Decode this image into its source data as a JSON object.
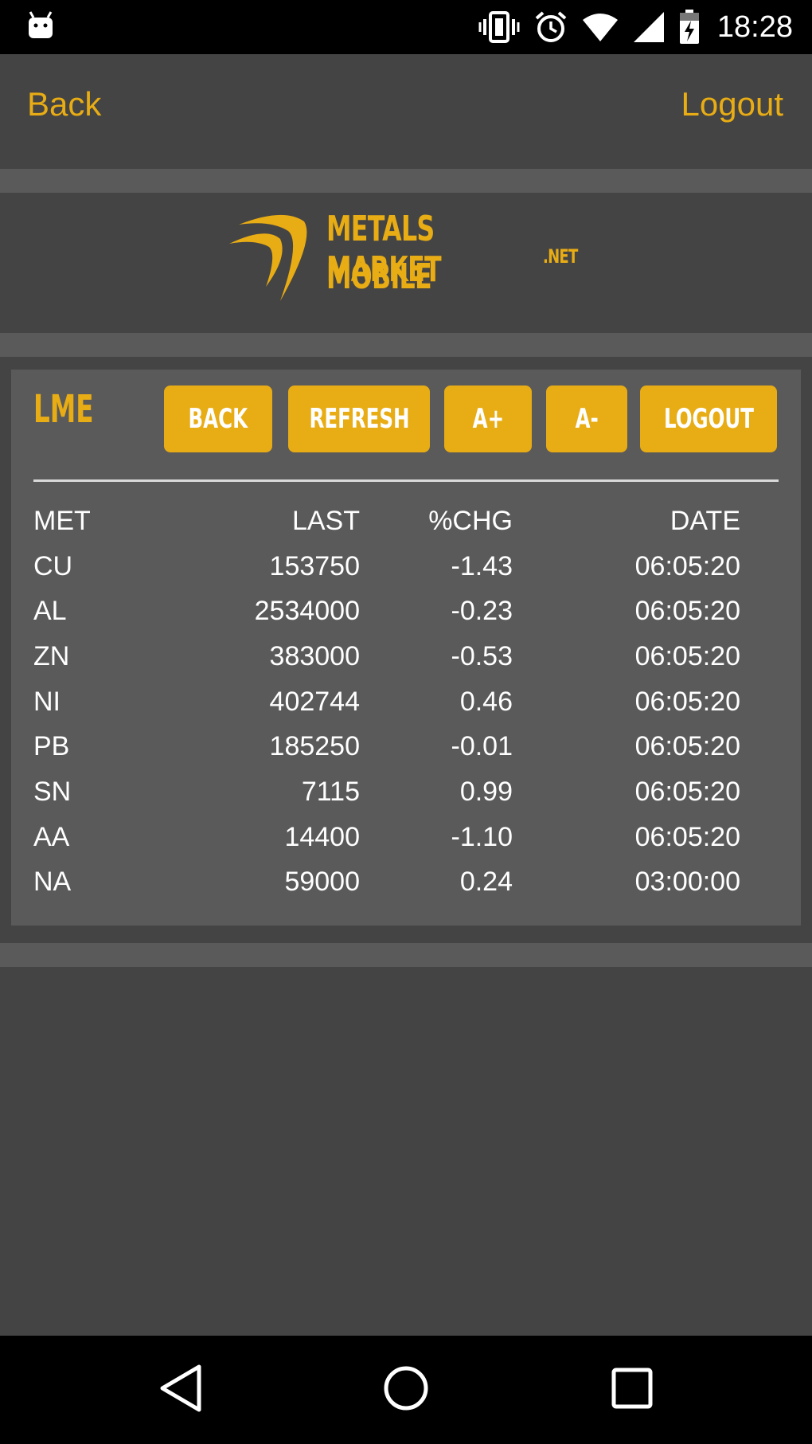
{
  "status_bar": {
    "time": "18:28"
  },
  "top_nav": {
    "back_label": "Back",
    "logout_label": "Logout"
  },
  "logo": {
    "line1": "METALS MARKET",
    "line2": "MOBILE",
    "suffix": ".NET"
  },
  "panel": {
    "title": "LME",
    "buttons": {
      "back": "BACK",
      "refresh": "REFRESH",
      "font_up": "A+",
      "font_down": "A-",
      "logout": "LOGOUT"
    }
  },
  "table": {
    "headers": {
      "met": "MET",
      "last": "LAST",
      "chg": "%CHG",
      "date": "DATE"
    },
    "rows": [
      {
        "met": "CU",
        "last": "153750",
        "chg": "-1.43",
        "date": "06:05:20"
      },
      {
        "met": "AL",
        "last": "2534000",
        "chg": "-0.23",
        "date": "06:05:20"
      },
      {
        "met": "ZN",
        "last": "383000",
        "chg": "-0.53",
        "date": "06:05:20"
      },
      {
        "met": "NI",
        "last": "402744",
        "chg": "0.46",
        "date": "06:05:20"
      },
      {
        "met": "PB",
        "last": "185250",
        "chg": "-0.01",
        "date": "06:05:20"
      },
      {
        "met": "SN",
        "last": "7115",
        "chg": "0.99",
        "date": "06:05:20"
      },
      {
        "met": "AA",
        "last": "14400",
        "chg": "-1.10",
        "date": "06:05:20"
      },
      {
        "met": "NA",
        "last": "59000",
        "chg": "0.24",
        "date": "03:00:00"
      }
    ]
  },
  "colors": {
    "accent": "#e8ac14",
    "background": "#444444",
    "panel": "#5a5a5a"
  },
  "icons": [
    "android-icon",
    "vibrate-icon",
    "alarm-icon",
    "wifi-icon",
    "cell-signal-icon",
    "battery-charging-icon",
    "back-nav-icon",
    "home-nav-icon",
    "recents-nav-icon"
  ]
}
